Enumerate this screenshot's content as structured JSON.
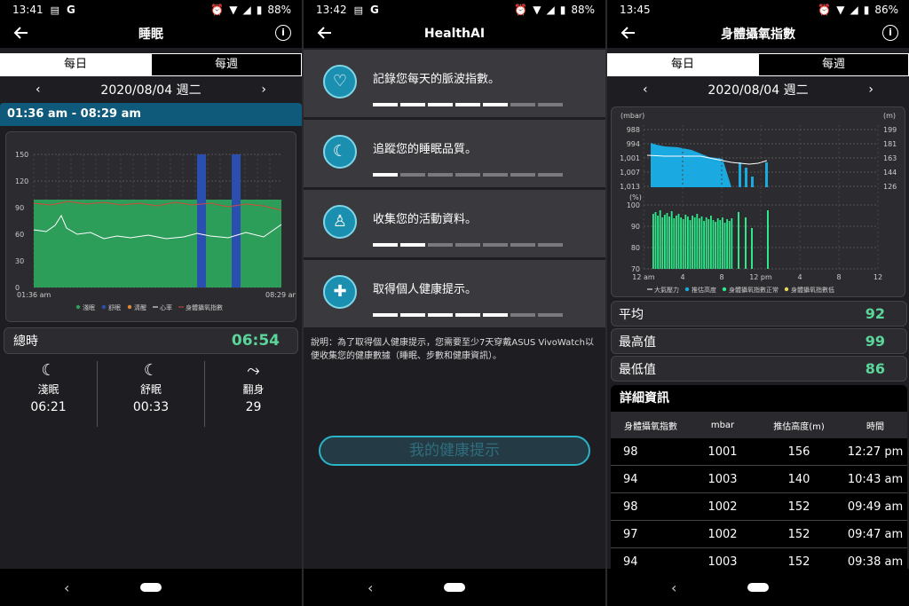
{
  "screen1": {
    "status": {
      "time": "13:41",
      "battery": "88%"
    },
    "title": "睡眠",
    "tabs": [
      "每日",
      "每週"
    ],
    "date": "2020/08/04 週二",
    "time_range": "01:36 am - 08:29 am",
    "chart": {
      "y_ticks": [
        "150",
        "120",
        "90",
        "60",
        "30",
        "0"
      ],
      "x_start": "01:36 am",
      "x_end": "08:29 am",
      "legend": [
        "淺眠",
        "舒眠",
        "清醒",
        "心率",
        "身體攝氧指數"
      ],
      "colors": {
        "light": "#2d9d5a",
        "deep": "#2b4fb0",
        "awake": "#e08a35",
        "hr": "#ffffff",
        "spo2": "#d04a3a"
      }
    },
    "total_label": "總時",
    "total_value": "06:54",
    "stats": [
      {
        "label": "淺眠",
        "value": "06:21"
      },
      {
        "label": "舒眠",
        "value": "00:33"
      },
      {
        "label": "翻身",
        "value": "29"
      }
    ]
  },
  "screen2": {
    "status": {
      "time": "13:42",
      "battery": "88%"
    },
    "title": "HealthAI",
    "items": [
      {
        "label": "記錄您每天的脈波指數。",
        "icon": "heart-monitor-icon",
        "progress": 5
      },
      {
        "label": "追蹤您的睡眠品質。",
        "icon": "sleep-icon",
        "progress": 1
      },
      {
        "label": "收集您的活動資料。",
        "icon": "activity-icon",
        "progress": 2
      },
      {
        "label": "取得個人健康提示。",
        "icon": "health-tips-icon",
        "progress": 5
      }
    ],
    "progress_total": 7,
    "note": "說明：為了取得個人健康提示，您需要至少7天穿戴ASUS VivoWatch以便收集您的健康數據（睡眠、步數和健康資訊）。",
    "button": "我的健康提示"
  },
  "screen3": {
    "status": {
      "time": "13:45",
      "battery": "86%"
    },
    "title": "身體攝氧指數",
    "tabs": [
      "每日",
      "每週"
    ],
    "date": "2020/08/04 週二",
    "chart_top": {
      "left_unit": "(mbar)",
      "right_unit": "(m)",
      "left_ticks": [
        "988",
        "994",
        "1,001",
        "1,007",
        "1,013"
      ],
      "right_ticks": [
        "199",
        "181",
        "163",
        "144",
        "126"
      ]
    },
    "chart_bottom": {
      "unit": "(%)",
      "y_ticks": [
        "100",
        "90",
        "80",
        "70"
      ],
      "x_ticks": [
        "12 am",
        "4",
        "8",
        "12 pm",
        "4",
        "8",
        "12"
      ]
    },
    "legend": [
      "大氣壓力",
      "推估高度",
      "身體攝氧指數正常",
      "身體攝氧指數低"
    ],
    "summary": [
      {
        "label": "平均",
        "value": "92"
      },
      {
        "label": "最高值",
        "value": "99"
      },
      {
        "label": "最低值",
        "value": "86"
      }
    ],
    "detail_title": "詳細資訊",
    "columns": [
      "身體攝氧指數",
      "mbar",
      "推估高度(m)",
      "時間"
    ],
    "rows": [
      [
        "98",
        "1001",
        "156",
        "12:27 pm"
      ],
      [
        "94",
        "1003",
        "140",
        "10:43 am"
      ],
      [
        "98",
        "1002",
        "152",
        "09:49 am"
      ],
      [
        "97",
        "1002",
        "152",
        "09:47 am"
      ],
      [
        "94",
        "1003",
        "152",
        "09:38 am"
      ]
    ]
  }
}
